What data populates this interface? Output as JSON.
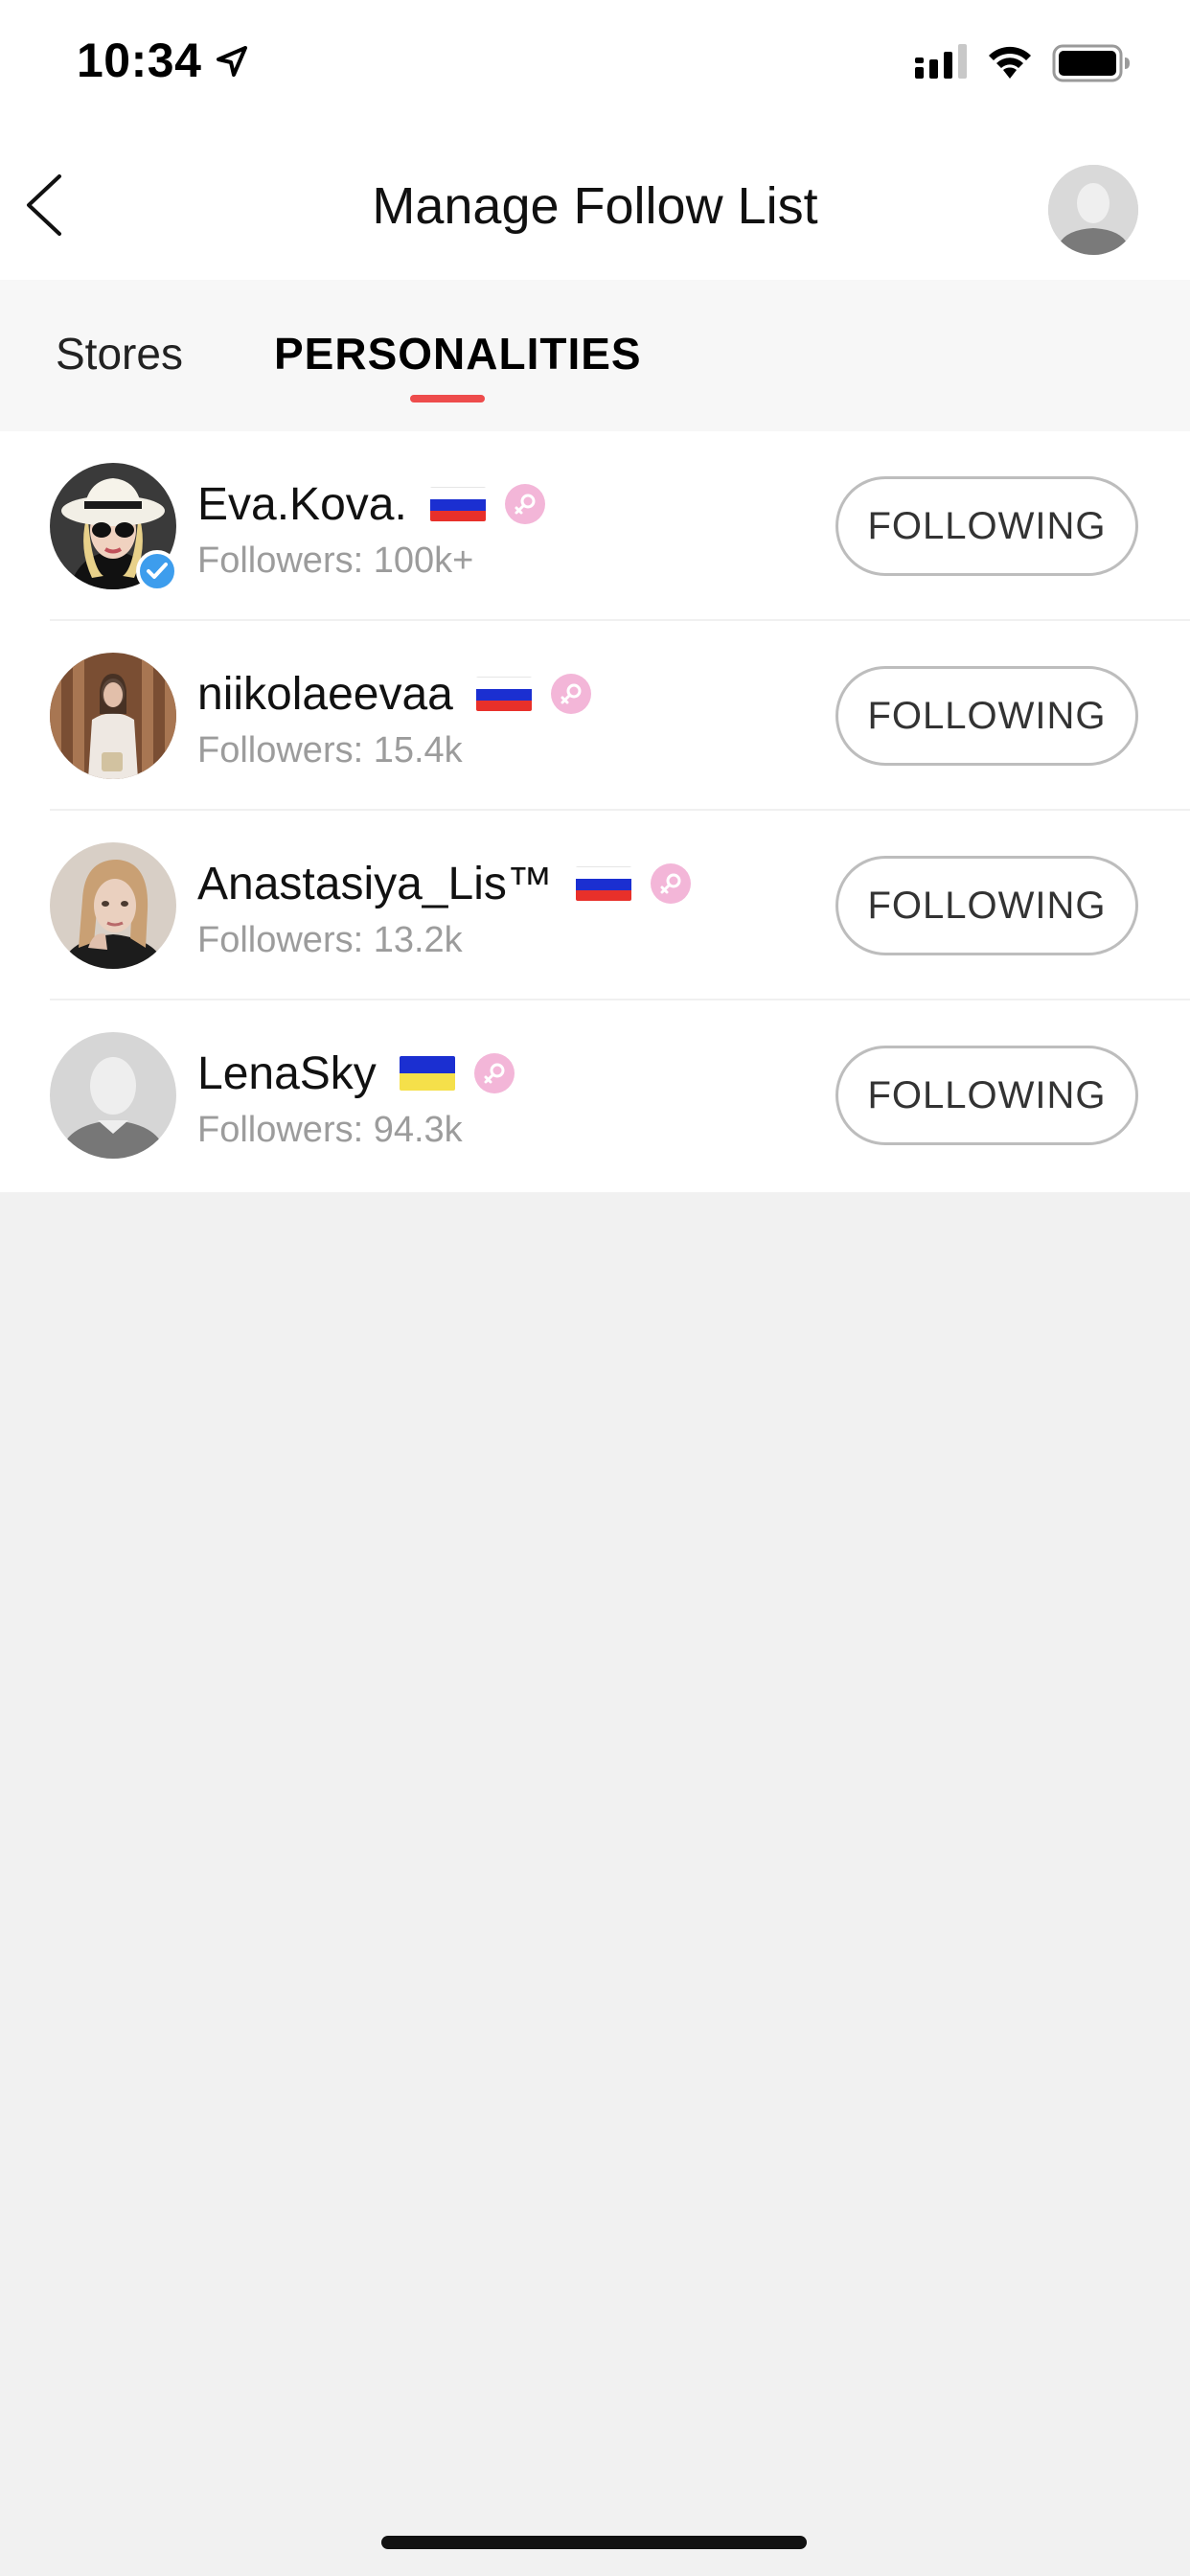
{
  "status_bar": {
    "time": "10:34"
  },
  "header": {
    "title": "Manage Follow List"
  },
  "tabs": [
    {
      "label": "Stores",
      "active": false
    },
    {
      "label": "PERSONALITIES",
      "active": true
    }
  ],
  "colors": {
    "accent": "#ee4c4c",
    "verified": "#3d9ded",
    "female_badge": "#f3b6d8",
    "follower_text": "#9c9c9c"
  },
  "personalities": [
    {
      "name": "Eva.Kova.",
      "flag": "russia",
      "gender": "female",
      "verified": true,
      "followers": "Followers: 100k+",
      "button": "FOLLOWING"
    },
    {
      "name": "niikolaeevaa",
      "flag": "russia",
      "gender": "female",
      "verified": false,
      "followers": "Followers: 15.4k",
      "button": "FOLLOWING"
    },
    {
      "name": "Anastasiya_Lis™",
      "flag": "russia",
      "gender": "female",
      "verified": false,
      "followers": "Followers: 13.2k",
      "button": "FOLLOWING"
    },
    {
      "name": "LenaSky",
      "flag": "ukraine",
      "gender": "female",
      "verified": false,
      "followers": "Followers: 94.3k",
      "button": "FOLLOWING"
    }
  ]
}
